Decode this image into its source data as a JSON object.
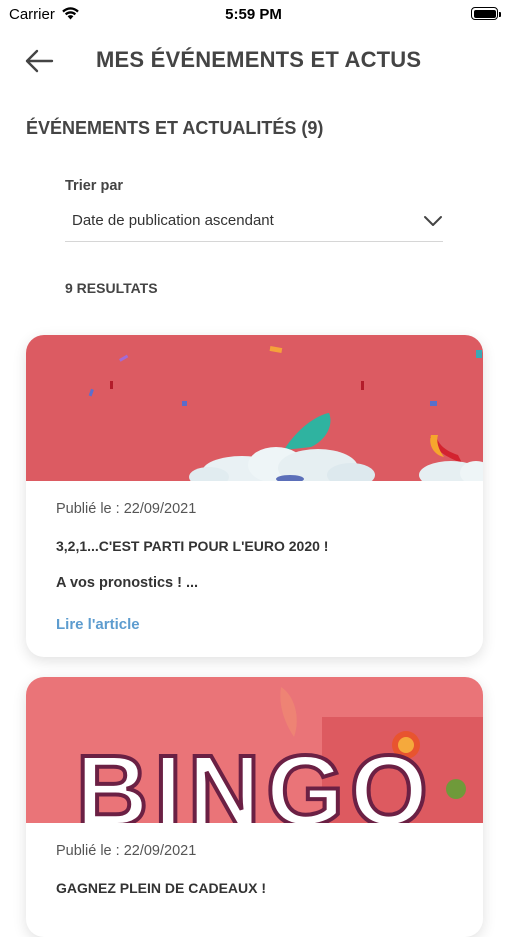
{
  "status_bar": {
    "carrier": "Carrier",
    "time": "5:59 PM"
  },
  "header": {
    "title": "MES ÉVÉNEMENTS ET ACTUS"
  },
  "section": {
    "title": "ÉVÉNEMENTS ET ACTUALITÉS (9)"
  },
  "sort": {
    "label": "Trier par",
    "selected": "Date de publication ascendant"
  },
  "results": {
    "count_label": "9 RESULTATS"
  },
  "articles": [
    {
      "date": "Publié le : 22/09/2021",
      "title": "3,2,1...C'EST PARTI POUR L'EURO 2020 !",
      "excerpt": "A vos pronostics ! ...",
      "link_label": "Lire l'article"
    },
    {
      "date": "Publié le : 22/09/2021",
      "title": "GAGNEZ PLEIN DE CADEAUX !",
      "banner_text": "BINGO"
    }
  ],
  "colors": {
    "accent_link": "#5d9ccf",
    "banner_red": "#dc5b62",
    "banner_pink": "#ea7478"
  }
}
